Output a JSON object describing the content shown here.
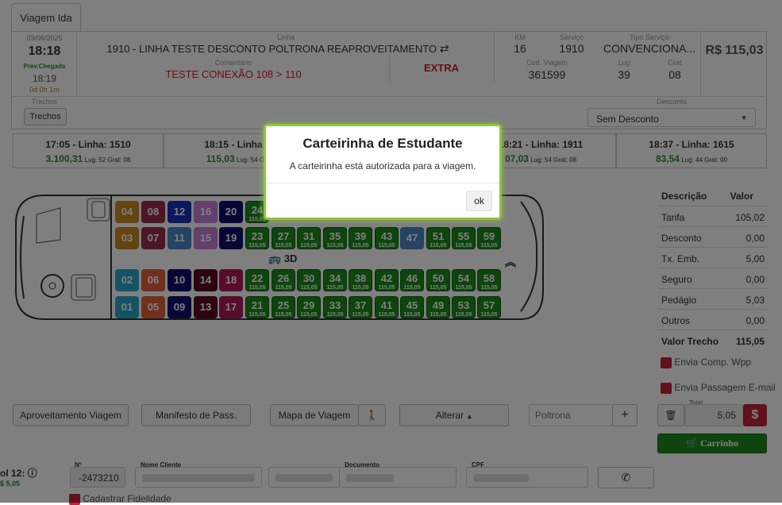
{
  "tab": "Viagem Ida",
  "trip": {
    "date": "03/06/2025",
    "time": "18:18",
    "prev_label": "Prev.Chegada",
    "prev_time": "18:19",
    "duration": "0d 0h 1m",
    "linha_label": "Linha",
    "linha": "1910 - LINHA TESTE DESCONTO POLTRONA REAPROVEITAMENTO",
    "km_label": "KM",
    "km": "16",
    "servico_label": "Serviço",
    "servico": "1910",
    "tipo_label": "Tipo Serviço",
    "tipo": "CONVENCIONA...",
    "price": "R$ 115,03",
    "comentario_label": "Comentário",
    "comentario": "TESTE CONEXÃO 108 > 110",
    "extra": "EXTRA",
    "cod_label": "Cod. Viagem",
    "cod": "361599",
    "lug_label": "Lug",
    "lug": "39",
    "grat_label": "Grat",
    "grat": "08",
    "trechos_label": "Trechos",
    "trechos_button": "Trechos",
    "desconto_label": "Desconto",
    "desconto_value": "Sem Desconto"
  },
  "routes": [
    {
      "title": "17:05 - Linha: 1510",
      "price": "3.100,31",
      "lug": "Lug: 52",
      "grat": "Grat: 08"
    },
    {
      "title": "18:15 - Linha: 1",
      "price": "115,03",
      "lug": "Lug: 54",
      "grat": "Grat"
    },
    {
      "title": "18:21 - Linha: 1911",
      "price": "07,03",
      "lug": "Lug: 54",
      "grat": "Grat: 08"
    },
    {
      "title": "18:37 - Linha: 1615",
      "price": "83,54",
      "lug": "Lug: 44",
      "grat": "Grat: 00"
    }
  ],
  "seat_price": "115,05",
  "bus_label": "3D",
  "seats": [
    {
      "n": "04",
      "c": "#c8881e"
    },
    {
      "n": "08",
      "c": "#9b2d4a"
    },
    {
      "n": "12",
      "c": "#1a2fbf"
    },
    {
      "n": "16",
      "c": "#c77fd6"
    },
    {
      "n": "20",
      "c": "#0d0d6e"
    },
    {
      "n": "24",
      "c": "#1a8a1a"
    },
    {
      "n": "03",
      "c": "#c8881e"
    },
    {
      "n": "07",
      "c": "#9b2d4a"
    },
    {
      "n": "11",
      "c": "#4a86c5"
    },
    {
      "n": "15",
      "c": "#c77fd6"
    },
    {
      "n": "19",
      "c": "#0d0d6e"
    },
    {
      "n": "23",
      "c": "#1a8a1a"
    },
    {
      "n": "27",
      "c": "#1a8a1a"
    },
    {
      "n": "31",
      "c": "#1a8a1a"
    },
    {
      "n": "35",
      "c": "#1a8a1a"
    },
    {
      "n": "39",
      "c": "#1a8a1a"
    },
    {
      "n": "43",
      "c": "#1a8a1a"
    },
    {
      "n": "47",
      "c": "#4a86c5"
    },
    {
      "n": "51",
      "c": "#1a8a1a"
    },
    {
      "n": "55",
      "c": "#1a8a1a"
    },
    {
      "n": "59",
      "c": "#1a8a1a"
    },
    {
      "n": "02",
      "c": "#2aa9c9"
    },
    {
      "n": "06",
      "c": "#e0603a"
    },
    {
      "n": "10",
      "c": "#0d0d6e"
    },
    {
      "n": "14",
      "c": "#5a0a1e"
    },
    {
      "n": "18",
      "c": "#b0185a"
    },
    {
      "n": "22",
      "c": "#1a8a1a"
    },
    {
      "n": "26",
      "c": "#1a8a1a"
    },
    {
      "n": "30",
      "c": "#1a8a1a"
    },
    {
      "n": "34",
      "c": "#1a8a1a"
    },
    {
      "n": "38",
      "c": "#1a8a1a"
    },
    {
      "n": "42",
      "c": "#1a8a1a"
    },
    {
      "n": "46",
      "c": "#1a8a1a"
    },
    {
      "n": "50",
      "c": "#1a8a1a"
    },
    {
      "n": "54",
      "c": "#1a8a1a"
    },
    {
      "n": "58",
      "c": "#1a8a1a"
    },
    {
      "n": "01",
      "c": "#2aa9c9"
    },
    {
      "n": "05",
      "c": "#e0603a"
    },
    {
      "n": "09",
      "c": "#0d0d6e"
    },
    {
      "n": "13",
      "c": "#5a0a1e"
    },
    {
      "n": "17",
      "c": "#b0185a"
    },
    {
      "n": "21",
      "c": "#1a8a1a"
    },
    {
      "n": "25",
      "c": "#1a8a1a"
    },
    {
      "n": "29",
      "c": "#1a8a1a"
    },
    {
      "n": "33",
      "c": "#1a8a1a"
    },
    {
      "n": "37",
      "c": "#1a8a1a"
    },
    {
      "n": "41",
      "c": "#1a8a1a"
    },
    {
      "n": "45",
      "c": "#1a8a1a"
    },
    {
      "n": "49",
      "c": "#1a8a1a"
    },
    {
      "n": "53",
      "c": "#1a8a1a"
    },
    {
      "n": "57",
      "c": "#1a8a1a"
    }
  ],
  "pricing": {
    "header_desc": "Descrição",
    "header_val": "Valor",
    "rows": [
      {
        "k": "Tarifa",
        "v": "105,02"
      },
      {
        "k": "Desconto",
        "v": "0,00"
      },
      {
        "k": "Tx. Emb.",
        "v": "5,00"
      },
      {
        "k": "Seguro",
        "v": "0,00"
      },
      {
        "k": "Pedágio",
        "v": "5,03"
      },
      {
        "k": "Outros",
        "v": "0,00"
      }
    ],
    "total_k": "Valor Trecho",
    "total_v": "115,05"
  },
  "options": {
    "wpp": "Envia Comp. Wpp",
    "email": "Envia Passagem E-mail"
  },
  "actions": {
    "aproveitamento": "Aproveitamento Viagem",
    "manifesto": "Manifesto de Pass.",
    "mapa": "Mapa de Viagem",
    "alterar": "Alterar",
    "poltrona_placeholder": "Poltrona",
    "total_label": "Total",
    "total_value": "5,05",
    "carrinho": "Carrinho"
  },
  "form": {
    "side_label": "ol 12:",
    "side_value": "$ 5,05",
    "num_label": "Nº",
    "num_value": "-2473210",
    "nome_label": "Nome Cliente",
    "documento_label": "Documento",
    "cpf_label": "CPF",
    "fidelidade": "Cadastrar Fidelidade"
  },
  "modal": {
    "title": "Carteirinha de Estudante",
    "body": "A carteirinha está autorizada para a viagem.",
    "ok": "ok"
  }
}
